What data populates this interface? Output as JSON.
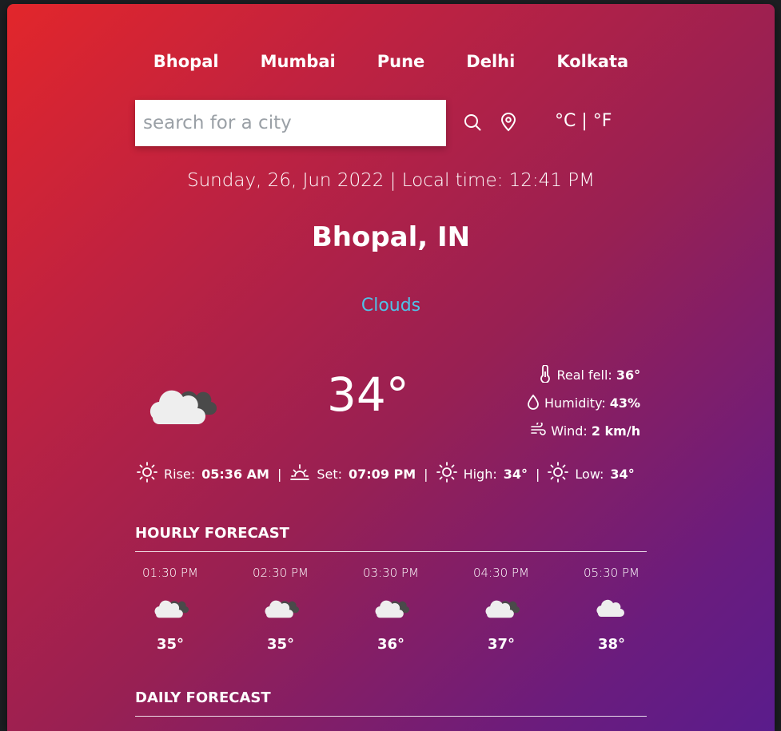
{
  "cities": [
    "Bhopal",
    "Mumbai",
    "Pune",
    "Delhi",
    "Kolkata"
  ],
  "search": {
    "placeholder": "search for a city"
  },
  "units": {
    "celsius": "°C",
    "separator": "|",
    "fahrenheit": "°F"
  },
  "datetime": "Sunday, 26, Jun 2022 | Local time: 12:41 PM",
  "location": "Bhopal, IN",
  "condition": "Clouds",
  "temperature": "34°",
  "details": {
    "real_feel_label": "Real fell:",
    "real_feel_value": "36°",
    "humidity_label": "Humidity:",
    "humidity_value": "43%",
    "wind_label": "Wind:",
    "wind_value": "2 km/h"
  },
  "sun": {
    "rise_label": "Rise:",
    "rise_value": "05:36 AM",
    "set_label": "Set:",
    "set_value": "07:09 PM",
    "high_label": "High:",
    "high_value": "34°",
    "low_label": "Low:",
    "low_value": "34°",
    "separator": "|"
  },
  "hourly_title": "HOURLY FORECAST",
  "hourly": [
    {
      "time": "01:30 PM",
      "temp": "35°",
      "icon": "cloud-broken-icon"
    },
    {
      "time": "02:30 PM",
      "temp": "35°",
      "icon": "cloud-broken-icon"
    },
    {
      "time": "03:30 PM",
      "temp": "36°",
      "icon": "cloud-broken-icon"
    },
    {
      "time": "04:30 PM",
      "temp": "37°",
      "icon": "cloud-broken-icon"
    },
    {
      "time": "05:30 PM",
      "temp": "38°",
      "icon": "cloud-scattered-icon"
    }
  ],
  "daily_title": "DAILY FORECAST",
  "colors": {
    "condition": "#4fc3e8",
    "gradient_start": "#e2262b",
    "gradient_end": "#5a1c8c"
  }
}
